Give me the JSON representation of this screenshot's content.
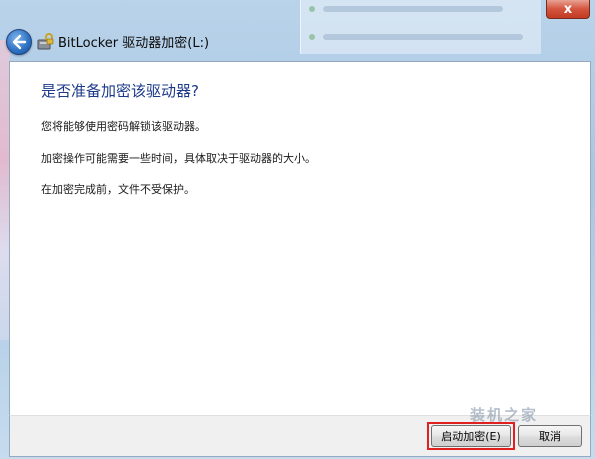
{
  "window": {
    "title": "BitLocker 驱动器加密(L:)",
    "close_label": "x"
  },
  "main": {
    "heading": "是否准备加密该驱动器?",
    "lines": [
      "您将能够使用密码解锁该驱动器。",
      "加密操作可能需要一些时间，具体取决于驱动器的大小。",
      "在加密完成前，文件不受保护。"
    ]
  },
  "footer": {
    "start_label": "启动加密(E)",
    "cancel_label": "取消"
  },
  "watermark": "装机之家",
  "colors": {
    "heading": "#1c3a8a",
    "highlight": "#e02020",
    "close": "#c23a22"
  }
}
